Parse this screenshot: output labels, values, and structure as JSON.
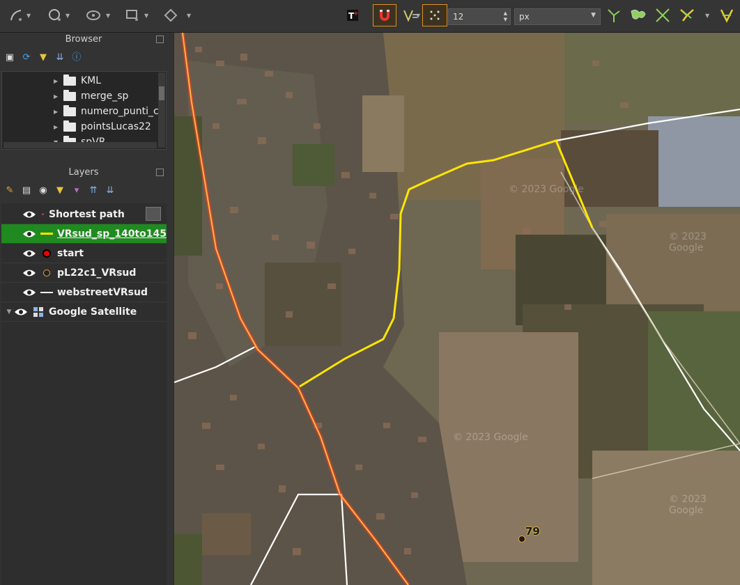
{
  "toolbar": {
    "spin_value": "12",
    "unit_value": "px",
    "icons": [
      "digitize-line-icon",
      "node-tool-icon",
      "simplify-icon",
      "offset-icon",
      "rotate-icon",
      "text-annotation-icon",
      "snapping-magnet-icon",
      "vertex-editor-icon",
      "snap-points-icon",
      "trim-extend-icon",
      "split-features-icon",
      "intersect-icon",
      "topology-icon",
      "self-snap-icon"
    ]
  },
  "browser": {
    "title": "Browser",
    "items": [
      {
        "label": "KML",
        "expanded": false
      },
      {
        "label": "merge_sp",
        "expanded": false
      },
      {
        "label": "numero_punti_co",
        "expanded": false
      },
      {
        "label": "pointsLucas22",
        "expanded": false
      },
      {
        "label": "spVR",
        "expanded": true
      }
    ]
  },
  "layers": {
    "title": "Layers",
    "items": [
      {
        "label": "Shortest path",
        "symbol": "none",
        "selected": false
      },
      {
        "label": "VRsud_sp_140to145",
        "symbol": "yellow-line",
        "selected": true
      },
      {
        "label": "start",
        "symbol": "red-point",
        "selected": false
      },
      {
        "label": "pL22c1_VRsud",
        "symbol": "orange-point",
        "selected": false
      },
      {
        "label": "webstreetVRsud",
        "symbol": "white-line",
        "selected": false
      },
      {
        "label": "Google Satellite",
        "symbol": "raster",
        "selected": false
      }
    ]
  },
  "map": {
    "watermarks": [
      "© 2023 Google",
      "© 2023 Google",
      "© 2023 Google",
      "© 2023 Google"
    ],
    "point_label": "79",
    "colors": {
      "shortest_path": "#ffe600",
      "main_road": "#ff5a1a",
      "street": "#ffffff"
    }
  }
}
